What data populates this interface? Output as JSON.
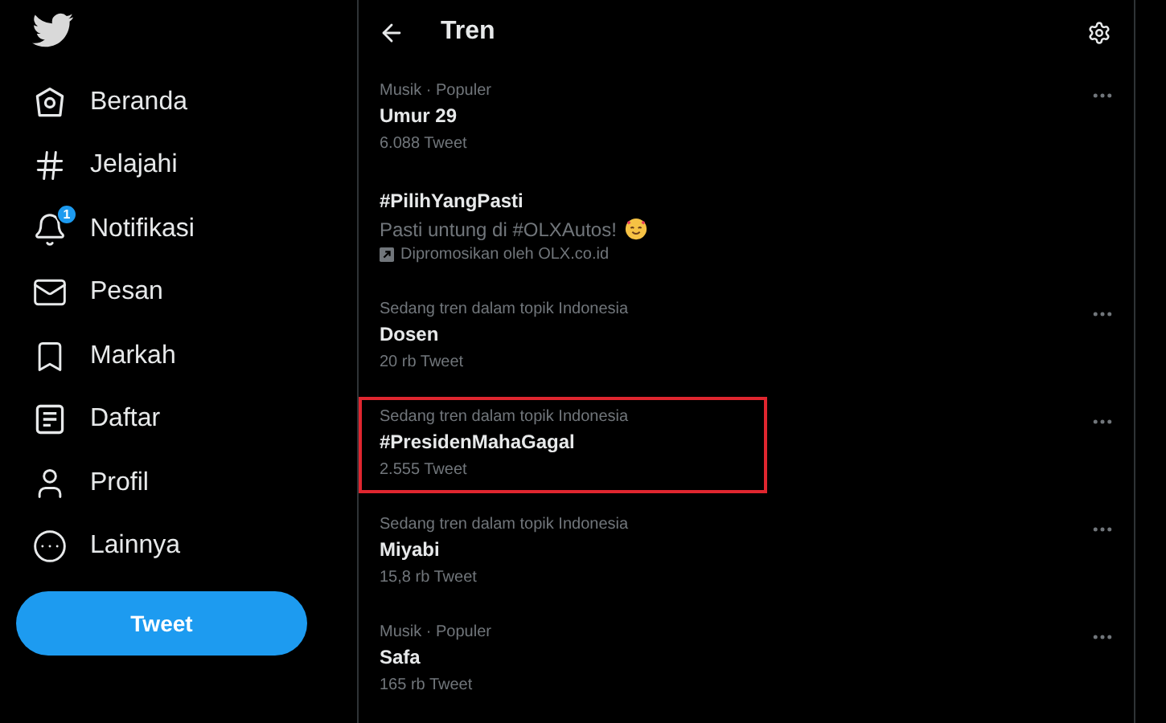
{
  "sidebar": {
    "items": [
      {
        "label": "Beranda",
        "selected": false
      },
      {
        "label": "Jelajahi",
        "selected": false
      },
      {
        "label": "Notifikasi",
        "selected": false,
        "badge": "1"
      },
      {
        "label": "Pesan",
        "selected": false
      },
      {
        "label": "Markah",
        "selected": false
      },
      {
        "label": "Daftar",
        "selected": false
      },
      {
        "label": "Profil",
        "selected": false
      },
      {
        "label": "Lainnya",
        "selected": false
      }
    ],
    "tweet_button": "Tweet"
  },
  "header": {
    "title": "Tren"
  },
  "trends": [
    {
      "kind": "trend",
      "context": "Musik · Populer",
      "name": "Umur 29",
      "count": "6.088 Tweet",
      "highlighted": false
    },
    {
      "kind": "promoted",
      "name": "#PilihYangPasti",
      "description": "Pasti untung di #OLXAutos!",
      "promoter": "Dipromosikan oleh OLX.co.id"
    },
    {
      "kind": "trend",
      "context": "Sedang tren dalam topik Indonesia",
      "name": "Dosen",
      "count": "20 rb Tweet",
      "highlighted": false
    },
    {
      "kind": "trend",
      "context": "Sedang tren dalam topik Indonesia",
      "name": "#PresidenMahaGagal",
      "count": "2.555 Tweet",
      "highlighted": true
    },
    {
      "kind": "trend",
      "context": "Sedang tren dalam topik Indonesia",
      "name": "Miyabi",
      "count": "15,8 rb Tweet",
      "highlighted": false
    },
    {
      "kind": "trend",
      "context": "Musik · Populer",
      "name": "Safa",
      "count": "165 rb Tweet",
      "highlighted": false
    }
  ]
}
